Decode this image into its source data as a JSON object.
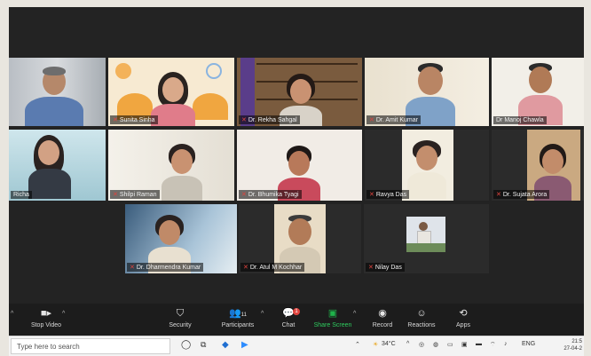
{
  "participants": [
    {
      "name": "",
      "show_label": false
    },
    {
      "name": "Sunita Sinha",
      "show_label": true
    },
    {
      "name": "Dr. Rekha Sahgal",
      "show_label": true
    },
    {
      "name": "Dr. Amit Kumar",
      "show_label": true
    },
    {
      "name": "Dr Manoj Chawla",
      "show_label": true
    },
    {
      "name": "Richa",
      "show_label": true
    },
    {
      "name": "Shilpi Raman",
      "show_label": true
    },
    {
      "name": "Dr. Bhumika Tyagi",
      "show_label": true
    },
    {
      "name": "Ravya Das",
      "show_label": true
    },
    {
      "name": "Dr. Sujata Arora",
      "show_label": true
    },
    {
      "name": "Dr. Dharmendra Kumar",
      "show_label": true
    },
    {
      "name": "Dr. Atul M Kochhar",
      "show_label": true
    },
    {
      "name": "Nilay Das",
      "show_label": true
    }
  ],
  "toolbar": {
    "stop_video": "Stop Video",
    "security": "Security",
    "participants": "Participants",
    "participants_count": "11",
    "chat": "Chat",
    "chat_badge": "1",
    "share_screen": "Share Screen",
    "record": "Record",
    "reactions": "Reactions",
    "apps": "Apps"
  },
  "taskbar": {
    "search_placeholder": "Type here to search",
    "weather": "34°C",
    "language": "ENG",
    "time": "21:5",
    "date": "27-04-2"
  },
  "icons": {
    "start": "windows-start-icon",
    "task_view": "task-view-icon",
    "edge": "edge-browser-icon",
    "zoom": "zoom-app-icon"
  },
  "colors": {
    "share_green": "#1fb24a",
    "chat_badge": "#e0443e",
    "gallery_bg": "#232323"
  }
}
